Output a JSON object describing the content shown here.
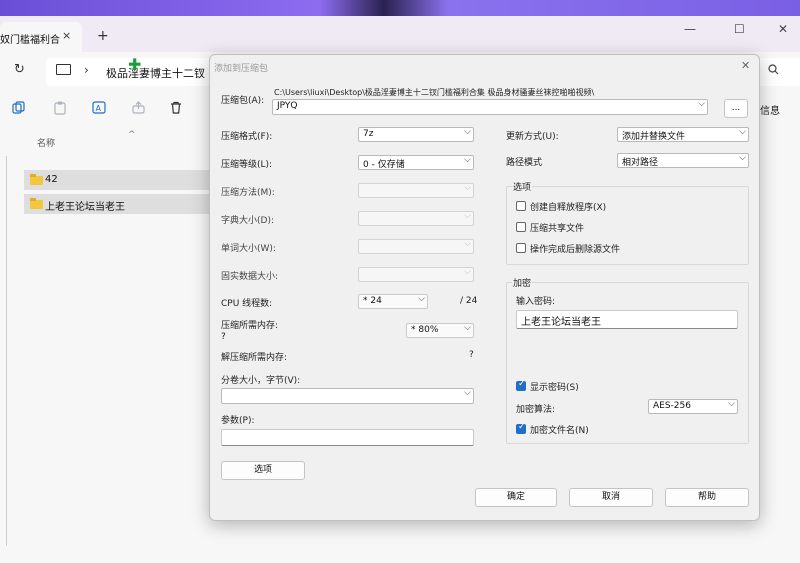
{
  "window": {
    "tab_title": "奴门槛福利合",
    "tab_close": "×",
    "new_tab": "+",
    "minimize": "—",
    "maximize": "☐",
    "close": "✕"
  },
  "address_bar": {
    "refresh": "↻",
    "chevron": "›",
    "path_text": "极品淫妻博主十二钗"
  },
  "toolbar": {
    "details_label": "信息"
  },
  "file_list": {
    "column_name": "名称",
    "sort_arrow": "^",
    "items": [
      {
        "name": "42"
      },
      {
        "name": "上老王论坛当老王"
      }
    ]
  },
  "dialog": {
    "title": "添加到压缩包",
    "close": "✕",
    "archive_label": "压缩包(A):",
    "archive_path": "C:\\Users\\liuxi\\Desktop\\极品淫妻博主十二钗门槛福利合集 极品身材骚妻丝袜控啪啪视频\\",
    "archive_name": "JPYQ",
    "browse_label": "...",
    "format_label": "压缩格式(F):",
    "format_value": "7z",
    "level_label": "压缩等级(L):",
    "level_value": "0 - 仅存储",
    "method_label": "压缩方法(M):",
    "dict_label": "字典大小(D):",
    "word_label": "单词大小(W):",
    "solid_label": "固实数据大小:",
    "cpu_label": "CPU 线程数:",
    "cpu_value": "* 24",
    "cpu_max": "/ 24",
    "mem_comp_label": "压缩所需内存:",
    "mem_comp_q": "?",
    "mem_comp_value": "* 80%",
    "mem_decomp_label": "解压缩所需内存:",
    "mem_decomp_value": "?",
    "volume_label": "分卷大小，字节(V):",
    "params_label": "参数(P):",
    "options_button": "选项",
    "update_label": "更新方式(U):",
    "update_value": "添加并替换文件",
    "pathmode_label": "路径模式",
    "pathmode_value": "相对路径",
    "options_group": "选项",
    "sfx_label": "创建自释放程序(X)",
    "shared_label": "压缩共享文件",
    "delete_label": "操作完成后删除源文件",
    "encrypt_group": "加密",
    "password_label": "输入密码:",
    "password_value": "上老王论坛当老王",
    "show_password_label": "显示密码(S)",
    "algo_label": "加密算法:",
    "algo_value": "AES-256",
    "encrypt_names_label": "加密文件名(N)",
    "ok_button": "确定",
    "cancel_button": "取消",
    "help_button": "帮助"
  }
}
